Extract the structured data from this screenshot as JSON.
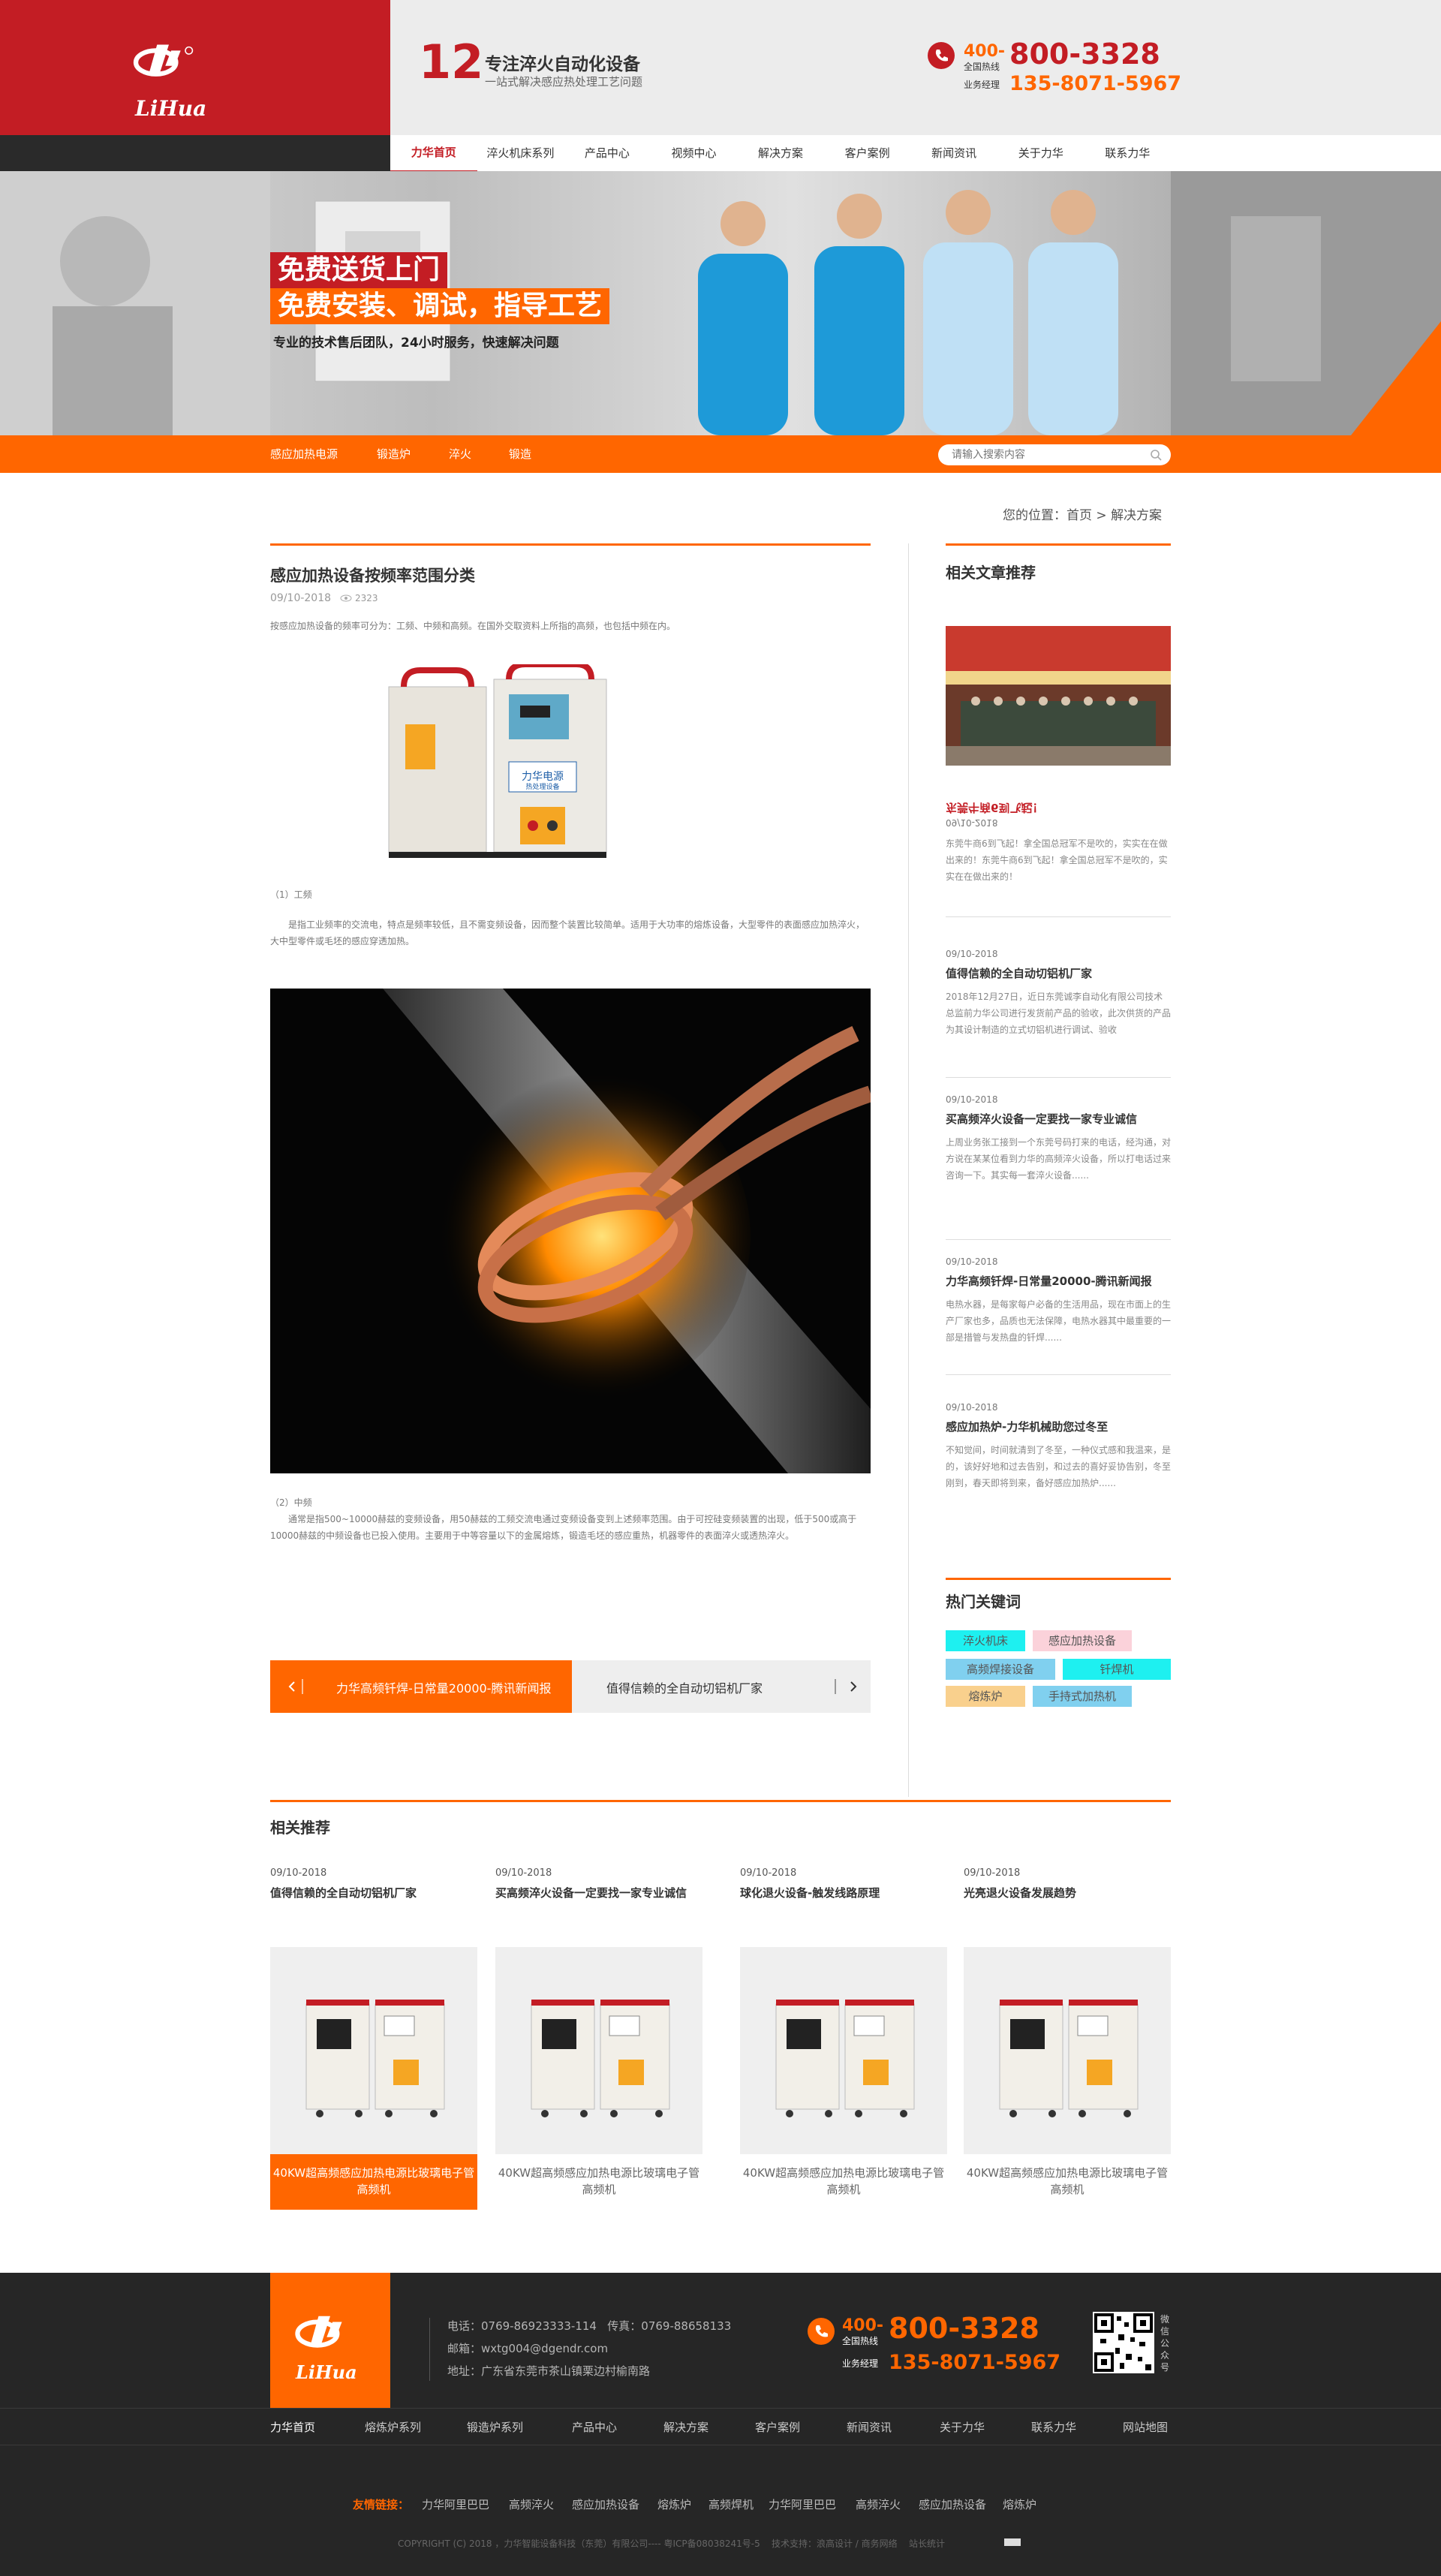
{
  "header": {
    "logo_text": "LiHua",
    "slogan_num": "12",
    "slogan_title": "专注淬火自动化设备",
    "slogan_sub": "一站式解决感应热处理工艺问题",
    "hotline_prefix": "400-",
    "hotline_label": "全国热线",
    "hotline": "800-3328",
    "manager_label": "业务经理",
    "manager_phone": "135-8071-5967"
  },
  "nav": [
    "力华首页",
    "淬火机床系列",
    "产品中心",
    "视频中心",
    "解决方案",
    "客户案例",
    "新闻资讯",
    "关于力华",
    "联系力华"
  ],
  "banner": {
    "line1": "免费送货上门",
    "line2": "免费安装、调试，指导工艺",
    "line3": "专业的技术售后团队，24小时服务，快速解决问题"
  },
  "subnav": [
    "感应加热电源",
    "锻造炉",
    "淬火",
    "锻造"
  ],
  "search": {
    "placeholder": "请输入搜索内容"
  },
  "breadcrumb": {
    "label": "您的位置：",
    "home": "首页",
    "sep": ">",
    "current": "解决方案"
  },
  "article": {
    "title": "感应加热设备按频率范围分类",
    "date": "09/10-2018",
    "views": "2323",
    "intro": "按感应加热设备的频率可分为：工频、中频和高频。在国外交取资料上所指的高频，也包括中频在内。",
    "machine_brand": "力华电源",
    "machine_sub": "热处理设备",
    "sec1_title": "（1）工频",
    "sec1_text": "是指工业频率的交流电，特点是频率较低，且不需变频设备，因而整个装置比较简单。适用于大功率的熔炼设备，大型零件的表面感应加热淬火，大中型零件或毛坯的感应穿透加热。",
    "sec2_title": "（2）中频",
    "sec2_text": "通常是指500~10000赫兹的变频设备，用50赫兹的工频交流电通过变频设备变到上述频率范围。由于可控硅变频装置的出现，低于500或高于10000赫兹的中频设备也已投入使用。主要用于中等容量以下的金属熔炼，锻造毛坯的感应重热，机器零件的表面淬火或透热淬火。"
  },
  "pager": {
    "prev_icon": "chevron-left",
    "prev": "力华高频钎焊-日常量20000-腾讯新闻报",
    "next": "值得信赖的全自动切铝机厂家",
    "next_icon": "chevron-right"
  },
  "sidebar": {
    "related_heading": "相关文章推荐",
    "items": [
      {
        "date": "09/10-2018",
        "title": "东莞牛商6到飞起！",
        "desc": "东莞牛商6到飞起！拿全国总冠军不是吹的，实实在在做出来的！东莞牛商6到飞起！拿全国总冠军不是吹的，实实在在做出来的！"
      },
      {
        "date": "09/10-2018",
        "title": "值得信赖的全自动切铝机厂家",
        "desc": "2018年12月27日，近日东莞诚李自动化有限公司技术总监前力华公司进行发货前产品的验收，此次供货的产品为其设计制造的立式切铝机进行调试、验收"
      },
      {
        "date": "09/10-2018",
        "title": "买高频淬火设备一定要找一家专业诚信",
        "desc": "上周业务张工接到一个东莞号码打来的电话，经沟通，对方说在某某位看到力华的高频淬火设备，所以打电话过来咨询一下。其实每一套淬火设备......"
      },
      {
        "date": "09/10-2018",
        "title": "力华高频钎焊-日常量20000-腾讯新闻报",
        "desc": "电热水器，是每家每户必备的生活用品，现在市面上的生产厂家也多，品质也无法保障，电热水器其中最重要的一部是措管与发热盘的钎焊......"
      },
      {
        "date": "09/10-2018",
        "title": "感应加热炉-力华机械助您过冬至",
        "desc": "不知觉间，时间就清到了冬至，一种仪式感和我温来，是的，该好好地和过去告别，和过去的喜好妥协告别，冬至刚到，春天即将到来，备好感应加热炉......"
      }
    ],
    "keywords_heading": "热门关键词",
    "keywords": [
      {
        "label": "淬火机床",
        "color": "#1ef0f0"
      },
      {
        "label": "感应加热设备",
        "color": "#fbd2da"
      },
      {
        "label": "高频焊接设备",
        "color": "#80d0ef"
      },
      {
        "label": "钎焊机",
        "color": "#1ef0f0"
      },
      {
        "label": "熔炼炉",
        "color": "#f9d08d"
      },
      {
        "label": "手持式加热机",
        "color": "#80d0ef"
      }
    ]
  },
  "related": {
    "heading": "相关推荐",
    "items": [
      {
        "date": "09/10-2018",
        "title": "值得信赖的全自动切铝机厂家",
        "caption": "40KW超高频感应加热电源比玻璃电子管高频机"
      },
      {
        "date": "09/10-2018",
        "title": "买高频淬火设备一定要找一家专业诚信",
        "caption": "40KW超高频感应加热电源比玻璃电子管高频机"
      },
      {
        "date": "09/10-2018",
        "title": "球化退火设备-触发线路原理",
        "caption": "40KW超高频感应加热电源比玻璃电子管高频机"
      },
      {
        "date": "09/10-2018",
        "title": "光亮退火设备发展趋势",
        "caption": "40KW超高频感应加热电源比玻璃电子管高频机"
      }
    ]
  },
  "footer": {
    "phone": "电话：0769-86923333-114",
    "fax": "传真：0769-88658133",
    "email": "邮箱：wxtg004@dgendr.com",
    "address": "地址：广东省东莞市茶山镇栗边村榆南路",
    "hotline_prefix": "400-",
    "hotline_label": "全国热线",
    "hotline": "800-3328",
    "manager_label": "业务经理",
    "manager_phone": "135-8071-5967",
    "qr_label": "微信公众号",
    "nav": [
      "力华首页",
      "熔炼炉系列",
      "锻造炉系列",
      "产品中心",
      "解决方案",
      "客户案例",
      "新闻资讯",
      "关于力华",
      "联系力华",
      "网站地图"
    ],
    "links_label": "友情链接：",
    "links": [
      "力华阿里巴巴",
      "高频淬火",
      "感应加热设备",
      "熔炼炉",
      "高频焊机",
      "力华阿里巴巴",
      "高频淬火",
      "感应加热设备",
      "熔炼炉"
    ],
    "copyright": "COPYRIGHT (C) 2018 ，力华智能设备科技（东莞）有限公司---- 粤ICP备08038241号-5",
    "support": "技术支持：浪高设计 / 商务网络",
    "stats": "站长统计"
  }
}
